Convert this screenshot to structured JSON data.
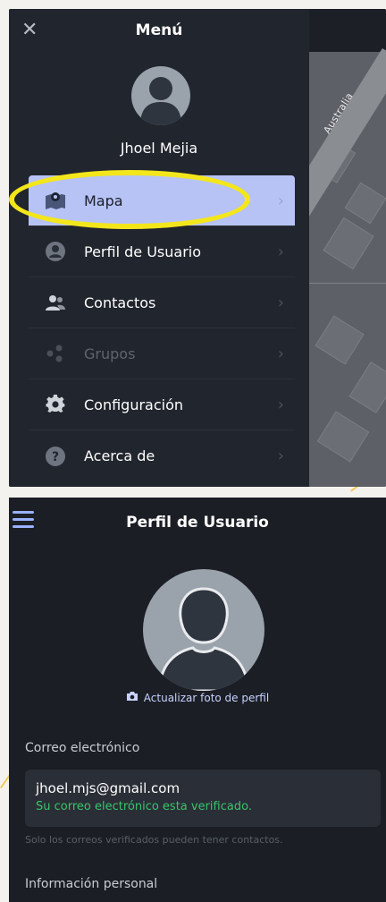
{
  "menu": {
    "title": "Menú",
    "close_icon": "close-icon",
    "user_name": "Jhoel Mejia",
    "items": [
      {
        "label": "Mapa",
        "icon": "map-icon",
        "active": true,
        "disabled": false
      },
      {
        "label": "Perfil de Usuario",
        "icon": "user-circle-icon",
        "active": false,
        "disabled": false
      },
      {
        "label": "Contactos",
        "icon": "contacts-icon",
        "active": false,
        "disabled": false
      },
      {
        "label": "Grupos",
        "icon": "groups-icon",
        "active": false,
        "disabled": true
      },
      {
        "label": "Configuración",
        "icon": "gear-icon",
        "active": false,
        "disabled": false
      },
      {
        "label": "Acerca de",
        "icon": "help-icon",
        "active": false,
        "disabled": false
      }
    ],
    "map_label": "Australia"
  },
  "profile": {
    "title": "Perfil de Usuario",
    "update_photo_label": "Actualizar foto de perfil",
    "email_section_label": "Correo electrónico",
    "email": "jhoel.mjs@gmail.com",
    "email_status": "Su correo electrónico esta verificado.",
    "email_note": "Solo los correos verificados pueden tener contactos.",
    "personal_section_label": "Información personal"
  },
  "colors": {
    "accent": "#b7c3f5",
    "highlight": "#f3e61b",
    "verified": "#39c46a",
    "background": "#21252d"
  }
}
